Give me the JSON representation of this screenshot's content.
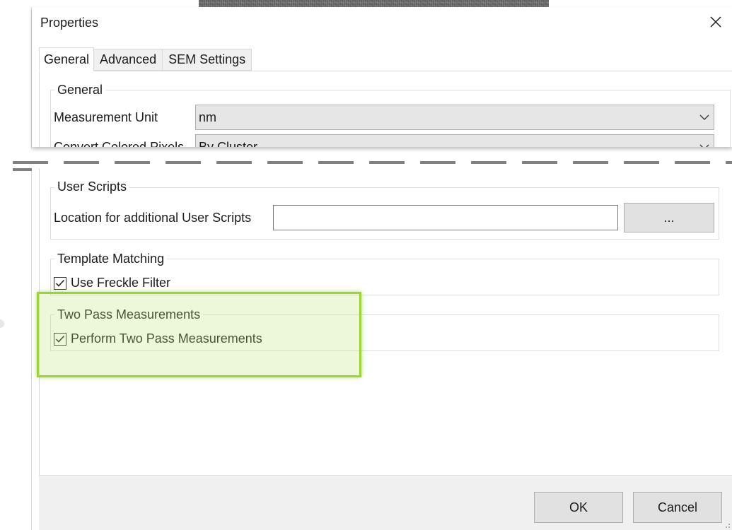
{
  "dialog": {
    "title": "Properties",
    "tabs": [
      {
        "label": "General",
        "active": true
      },
      {
        "label": "Advanced",
        "active": false
      },
      {
        "label": "SEM Settings",
        "active": false
      }
    ]
  },
  "general_group": {
    "legend": "General",
    "measurement_unit_label": "Measurement Unit",
    "measurement_unit_value": "nm",
    "convert_pixels_label": "Convert Colored Pixels",
    "convert_pixels_value": "By Cluster"
  },
  "user_scripts_group": {
    "legend": "User Scripts",
    "location_label": "Location for additional User Scripts",
    "location_value": "",
    "browse_label": "..."
  },
  "template_matching_group": {
    "legend": "Template Matching",
    "freckle_label": "Use Freckle Filter",
    "freckle_checked": true
  },
  "two_pass_group": {
    "legend": "Two Pass Measurements",
    "perform_label": "Perform Two Pass Measurements",
    "perform_checked": true
  },
  "footer": {
    "ok_label": "OK",
    "cancel_label": "Cancel"
  },
  "colors": {
    "highlight": "#9fd13a",
    "window_bg": "#ffffff",
    "footer_bg": "#f0f0f0",
    "button_bg": "#e1e1e1"
  },
  "icons": {
    "close": "close-icon",
    "chevron": "chevron-down-icon",
    "check": "check-icon",
    "resize": "resize-grip-icon"
  }
}
